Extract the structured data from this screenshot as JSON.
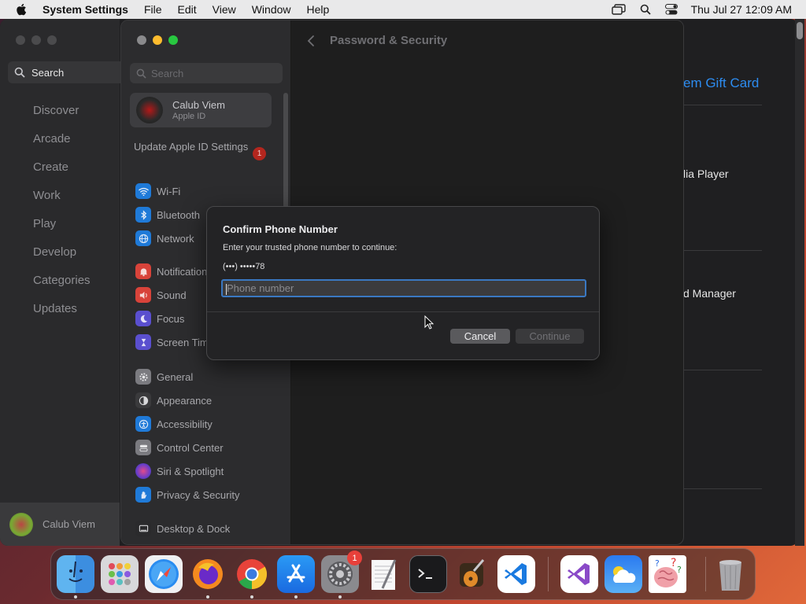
{
  "menubar": {
    "app_name": "System Settings",
    "menus": [
      "File",
      "Edit",
      "View",
      "Window",
      "Help"
    ],
    "clock": "Thu Jul 27  12:09 AM"
  },
  "appstore": {
    "search_placeholder": "Search",
    "nav": [
      "Discover",
      "Arcade",
      "Create",
      "Work",
      "Play",
      "Develop",
      "Categories",
      "Updates"
    ],
    "user_name": "Calub Viem",
    "right_items": [
      "em Gift Card",
      "lia Player",
      "d Manager"
    ],
    "link_color": "#2d8cf0"
  },
  "settings": {
    "search_placeholder": "Search",
    "user_name": "Calub Viem",
    "user_sub": "Apple ID",
    "update_label": "Update Apple ID Settings",
    "update_badge": "1",
    "items": [
      {
        "label": "Wi-Fi",
        "icon": "wifi-icon",
        "color": "#1f7ad8"
      },
      {
        "label": "Bluetooth",
        "icon": "bluetooth-icon",
        "color": "#1f7ad8"
      },
      {
        "label": "Network",
        "icon": "globe-icon",
        "color": "#1f7ad8"
      },
      {
        "label": "Notifications",
        "icon": "bell-icon",
        "color": "#d8433a"
      },
      {
        "label": "Sound",
        "icon": "speaker-icon",
        "color": "#d8433a"
      },
      {
        "label": "Focus",
        "icon": "moon-icon",
        "color": "#5a4fcf"
      },
      {
        "label": "Screen Time",
        "icon": "hourglass-icon",
        "color": "#5a4fcf"
      },
      {
        "label": "General",
        "icon": "gear-icon",
        "color": "#7b7b80"
      },
      {
        "label": "Appearance",
        "icon": "appearance-icon",
        "color": "#2a2a2c"
      },
      {
        "label": "Accessibility",
        "icon": "accessibility-icon",
        "color": "#1f7ad8"
      },
      {
        "label": "Control Center",
        "icon": "control-center-icon",
        "color": "#7b7b80"
      },
      {
        "label": "Siri & Spotlight",
        "icon": "siri-icon",
        "color": "#6a3dc8"
      },
      {
        "label": "Privacy & Security",
        "icon": "hand-icon",
        "color": "#1f7ad8"
      },
      {
        "label": "Desktop & Dock",
        "icon": "desktop-icon",
        "color": "#2a2a2c"
      }
    ],
    "content_title": "Password & Security"
  },
  "dialog": {
    "title": "Confirm Phone Number",
    "subtitle": "Enter your trusted phone number to continue:",
    "masked_number": "(•••) •••••78",
    "phone_value": "",
    "phone_placeholder": "Phone number",
    "cancel_label": "Cancel",
    "continue_label": "Continue",
    "focus_color": "#3a78c2"
  },
  "dock": {
    "apps": [
      "Finder",
      "Launchpad",
      "Safari",
      "Firefox",
      "Chrome",
      "App Store",
      "System Settings",
      "TextEdit",
      "Terminal",
      "GarageBand",
      "Visual Studio Code",
      "Visual Studio",
      "Weather",
      "Brain Test",
      "Trash"
    ],
    "settings_badge": "1"
  }
}
